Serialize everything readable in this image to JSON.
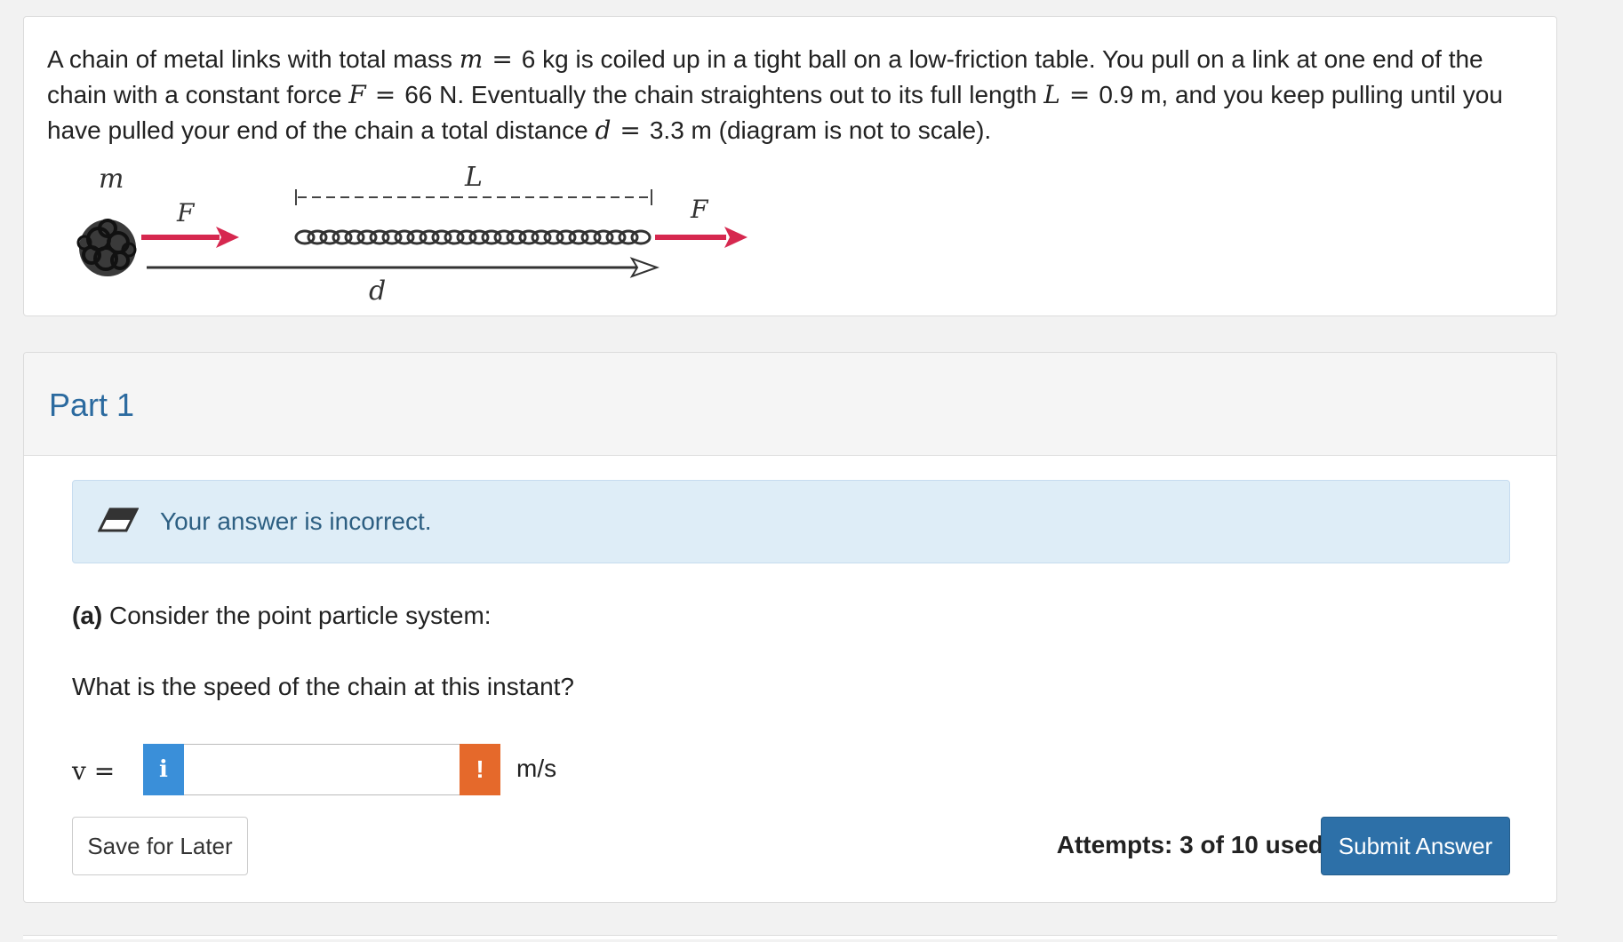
{
  "problem": {
    "text_1": "A chain of metal links with total mass",
    "m_var": "m",
    "eq_sign": "=",
    "m_value": "6 kg is coiled up in a tight ball on a low-friction table. You pull on a link at one end of the chain with a constant force",
    "F_var": "F",
    "F_value": "66 N. Eventually the chain straightens out to its full length",
    "L_var": "L",
    "L_value": "0.9 m, and you keep pulling until you have pulled your end of the chain a total distance",
    "d_var": "d",
    "d_value": "3.3 m (diagram is not to scale)."
  },
  "diagram": {
    "label_m": "m",
    "label_F_left": "F",
    "label_L": "L",
    "label_F_right": "F",
    "label_d": "d",
    "arrow_color": "#d6284f"
  },
  "part": {
    "title": "Part 1",
    "feedback_icon": "eraser-icon",
    "feedback_text": "Your answer is incorrect.",
    "question_a_bold": "(a)",
    "question_a_text": " Consider the point particle system:",
    "question_b": "What is the speed of the chain at this instant?",
    "var_label": "v =",
    "info_label": "i",
    "input_value": "",
    "warn_label": "!",
    "unit": "m/s",
    "save_label": "Save for Later",
    "attempts": "Attempts: 3 of 10 used",
    "submit_label": "Submit Answer"
  },
  "colors": {
    "accent": "#2d70a8",
    "info": "#3a8fd9",
    "warn": "#e5692b",
    "feedback_bg": "#deedf7"
  }
}
